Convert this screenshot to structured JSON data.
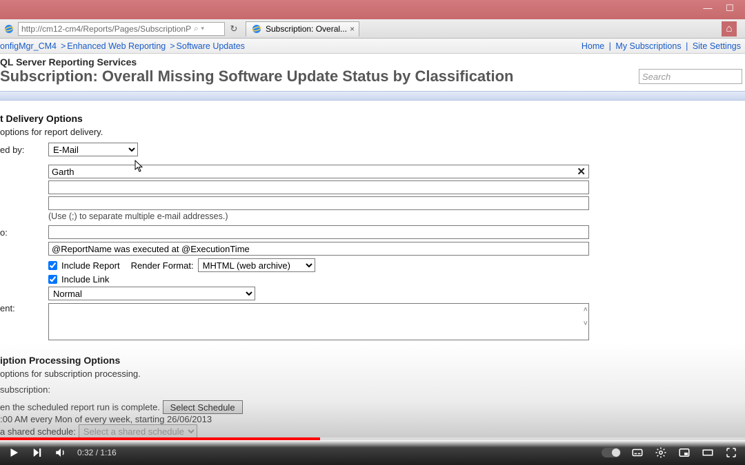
{
  "window": {
    "minimize_glyph": "—",
    "maximize_glyph": "☐"
  },
  "browser": {
    "url": "http://cm12-cm4/Reports/Pages/SubscriptionP",
    "url_tail_icons": "⌕ ▾",
    "refresh": "↻",
    "tab_label": "Subscription: Overal...",
    "tab_close": "×",
    "home_glyph": "⌂"
  },
  "nav": {
    "crumbs": [
      "onfigMgr_CM4",
      "Enhanced Web Reporting",
      "Software Updates"
    ],
    "right": [
      "Home",
      "My Subscriptions",
      "Site Settings"
    ]
  },
  "header": {
    "service": "QL Server Reporting Services",
    "title": "Subscription: Overall Missing Software Update Status by Classification",
    "search_placeholder": "Search"
  },
  "delivery": {
    "section_title": "t Delivery Options",
    "desc": "options for report delivery.",
    "delivered_by_label": "ed by:",
    "delivered_by_value": "E-Mail",
    "to_value": "Garth",
    "hint": "(Use (;) to separate multiple e-mail addresses.)",
    "replyto_label": "o:",
    "subject_value": "@ReportName was executed at @ExecutionTime",
    "include_report": "Include Report",
    "render_format_label": "Render Format:",
    "render_format_value": "MHTML (web archive)",
    "include_link": "Include Link",
    "priority_value": "Normal",
    "comment_label": "ent:"
  },
  "processing": {
    "section_title": "iption Processing Options",
    "desc": "options for subscription processing.",
    "run_label": "subscription:",
    "when_label": "en the scheduled report run is complete.",
    "select_schedule": "Select Schedule",
    "schedule_summary": ":00 AM every Mon of every week, starting 26/06/2013",
    "shared_label": "a shared schedule:",
    "shared_value": "Select a shared schedule"
  },
  "video": {
    "current": "0:32",
    "duration": "1:16"
  }
}
